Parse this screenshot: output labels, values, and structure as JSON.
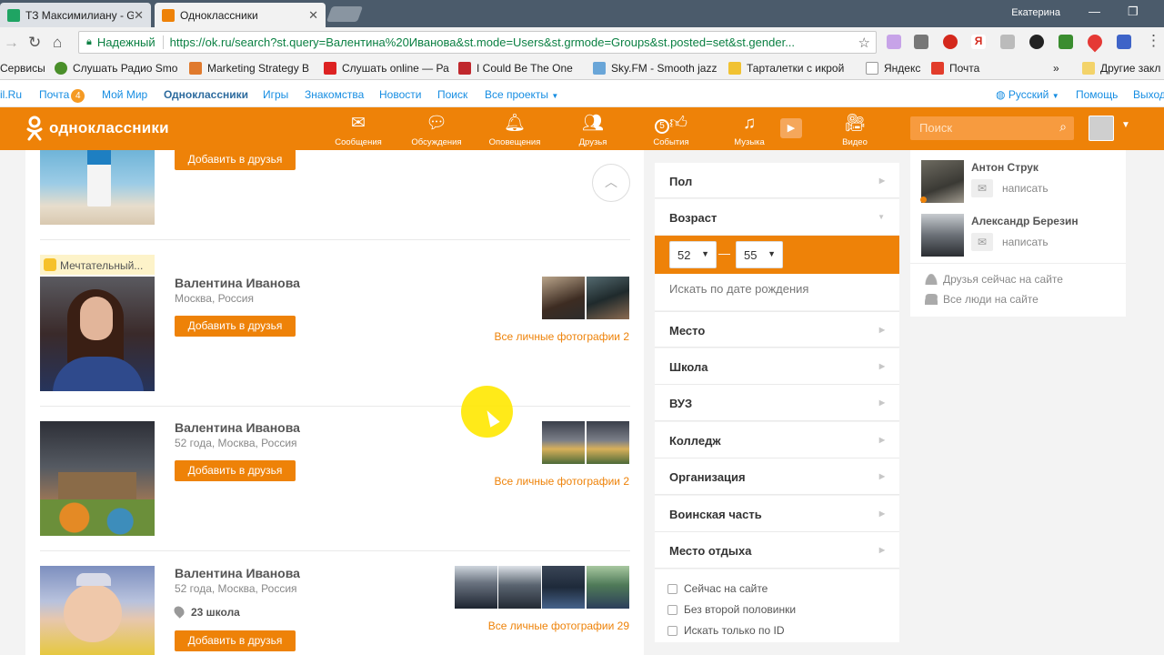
{
  "browser": {
    "tabs": [
      {
        "title": "ТЗ Максимилиану - Goo"
      },
      {
        "title": "Одноклассники"
      }
    ],
    "window_user": "Екатерина",
    "secure_label": "Надежный",
    "url": "https://ok.ru/search?st.query=Валентина%20Иванова&st.mode=Users&st.grmode=Groups&st.posted=set&st.gender...",
    "bookmarks": [
      "Сервисы",
      "Слушать Радио Smo",
      "Marketing Strategy B",
      "Слушать online — Ра",
      "I Could Be The One",
      "Sky.FM - Smooth jazz",
      "Тарталетки с икрой",
      "Яндекс",
      "Почта",
      "Другие закл"
    ],
    "more_bookmarks": "»"
  },
  "portal": {
    "mailru": "il.Ru",
    "mail": "Почта",
    "mail_count": "4",
    "my_world": "Мой Мир",
    "ok": "Одноклассники",
    "games": "Игры",
    "dating": "Знакомства",
    "news": "Новости",
    "search": "Поиск",
    "all_projects": "Все проекты",
    "language": "Русский",
    "help": "Помощь",
    "logout": "Выход"
  },
  "ok_header": {
    "logo": "одноклассники",
    "nav": [
      {
        "label": "Сообщения",
        "icon": "envelope-icon"
      },
      {
        "label": "Обсуждения",
        "icon": "chat-icon"
      },
      {
        "label": "Оповещения",
        "icon": "bell-icon"
      },
      {
        "label": "Друзья",
        "icon": "friends-icon"
      },
      {
        "label": "События",
        "icon": "events-icon",
        "badge": "5"
      },
      {
        "label": "Музыка",
        "icon": "music-icon"
      },
      {
        "label": "Видео",
        "icon": "video-icon"
      }
    ],
    "search_placeholder": "Поиск"
  },
  "results": {
    "add_label": "Добавить в друзья",
    "people": [
      {
        "name": "Валентина Иванова",
        "mood": "Мечтательный...",
        "info": "Москва, Россия",
        "photos_link": "Все личные фотографии 2"
      },
      {
        "name": "Валентина Иванова",
        "info": "52 года, Москва, Россия",
        "photos_link": "Все личные фотографии 2"
      },
      {
        "name": "Валентина Иванова",
        "info": "52 года, Москва, Россия",
        "school": "23 школа",
        "photos_link": "Все личные фотографии 29"
      }
    ]
  },
  "filters": {
    "gender": "Пол",
    "age": "Возраст",
    "age_from": "52",
    "age_to": "55",
    "age_dash": "—",
    "by_birthdate": "Искать по дате рождения",
    "items": [
      "Место",
      "Школа",
      "ВУЗ",
      "Колледж",
      "Организация",
      "Воинская часть",
      "Место отдыха"
    ],
    "checkboxes": [
      "Сейчас на сайте",
      "Без второй половинки",
      "Искать только по ID"
    ]
  },
  "friends_panel": {
    "friends": [
      {
        "name": "Антон Струк",
        "action": "написать"
      },
      {
        "name": "Александр Березин",
        "action": "написать"
      }
    ],
    "online_friends": "Друзья сейчас на сайте",
    "all_online": "Все люди на сайте"
  },
  "colors": {
    "ok_orange": "#ee8208",
    "link_blue": "#168de2"
  }
}
